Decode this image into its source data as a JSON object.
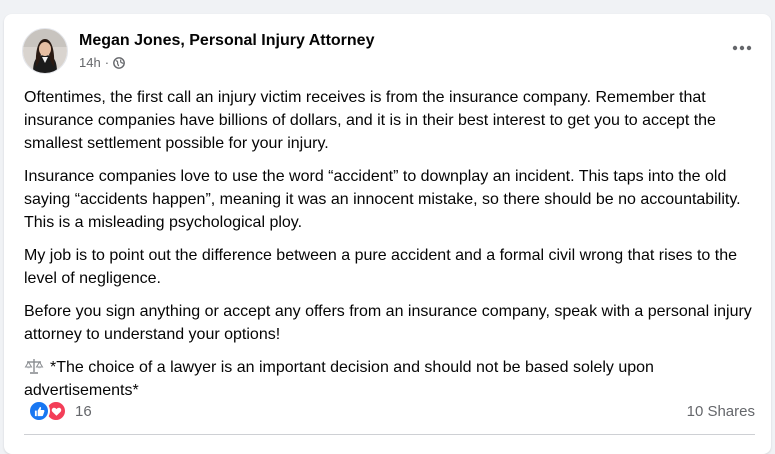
{
  "post": {
    "author": "Megan Jones, Personal Injury Attorney",
    "time": "14h",
    "dot": "·",
    "privacy_icon": "globe-icon",
    "more_icon": "more-options-icon",
    "paragraphs": [
      "Oftentimes, the first call an injury victim receives is from the insurance company. Remember that insurance companies have billions of dollars, and it is in their best interest to get you to accept the smallest settlement possible for your injury.",
      "Insurance companies love to use the word “accident” to downplay an incident. This taps into the old saying “accidents happen”, meaning it was an innocent mistake, so there should be no accountability. This is a misleading psychological ploy.",
      "My job is to point out the difference between a pure accident and a formal civil wrong that rises to the level of negligence.",
      "Before you sign anything or accept any offers from an insurance company, speak with a personal injury attorney to understand your options!"
    ],
    "disclaimer": "*The choice of a lawyer is an important decision and should not be based solely upon advertisements*",
    "disclaimer_icon": "scales-icon"
  },
  "footer": {
    "reaction_icons": [
      "like-icon",
      "love-icon"
    ],
    "reaction_count": "16",
    "shares": "10 Shares"
  },
  "colors": {
    "like": "#1877f2",
    "love": "#f33e58",
    "text": "#050505",
    "muted": "#65676b"
  }
}
